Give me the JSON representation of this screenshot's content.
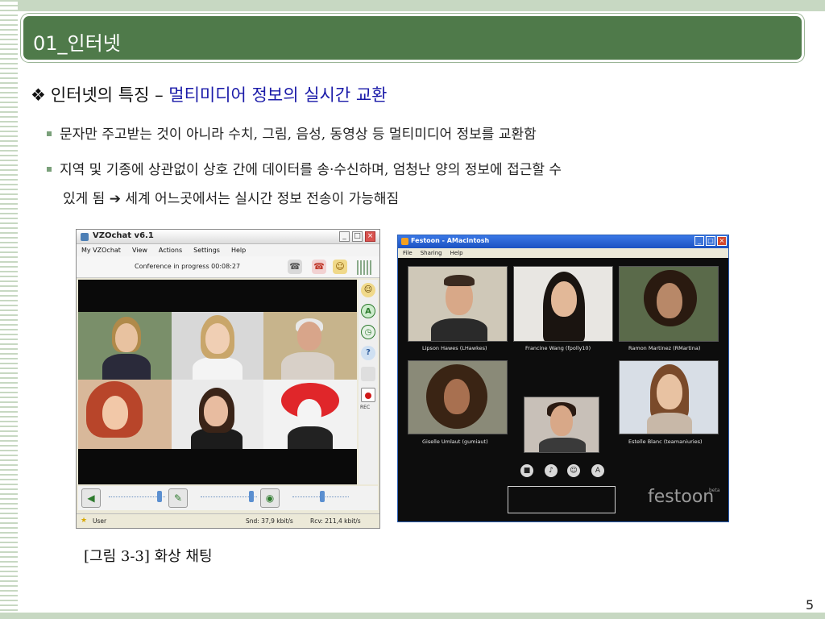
{
  "slide": {
    "title": "01_인터넷",
    "bullet_main": {
      "symbol": "❖",
      "prefix": "인터넷의 특징 – ",
      "highlight": "멀티미디어 정보의 실시간 교환"
    },
    "sub_bullets": [
      "문자만 주고받는 것이 아니라 수치, 그림, 음성, 동영상 등 멀티미디어 정보를 교환함",
      "지역 및 기종에 상관없이 상호 간에 데이터를 송·수신하며, 엄청난 양의 정보에 접근할 수",
      "있게 됨 ➔ 세계 어느곳에서는 실시간 정보 전송이 가능해짐"
    ],
    "caption": "[그림 3-3] 화상 채팅",
    "page_number": "5"
  },
  "vzochat": {
    "title": "VZOchat v6.1",
    "menu": [
      "My VZOchat",
      "View",
      "Actions",
      "Settings",
      "Help"
    ],
    "status": "Conference in progress 00:08:27",
    "side_icons": [
      "users-icon",
      "a-icon",
      "clock-icon",
      "help-icon",
      "blank-icon",
      "rec-icon"
    ],
    "rec_label": "REC",
    "user_label": "User",
    "snd": "Snd: 37,9 kbit/s",
    "rcv": "Rcv: 211,4 kbit/s"
  },
  "festoon": {
    "title": "Festoon - AMacintosh",
    "menu": [
      "File",
      "Sharing",
      "Help"
    ],
    "participants": [
      "Lipson Hawes (LHawkes)",
      "Francine Wang (fpolly10)",
      "Ramon Martinez (RMartina)",
      "Giselle Umlaut (gumiaut)",
      "Estelle Blanc (teamaniuries)"
    ],
    "logo": "festoon",
    "logo_tag": "beta"
  },
  "colors": {
    "title_bar": "#4f7a4a",
    "highlight_text": "#1a1aa8",
    "decor_green": "#c7d8c2"
  }
}
